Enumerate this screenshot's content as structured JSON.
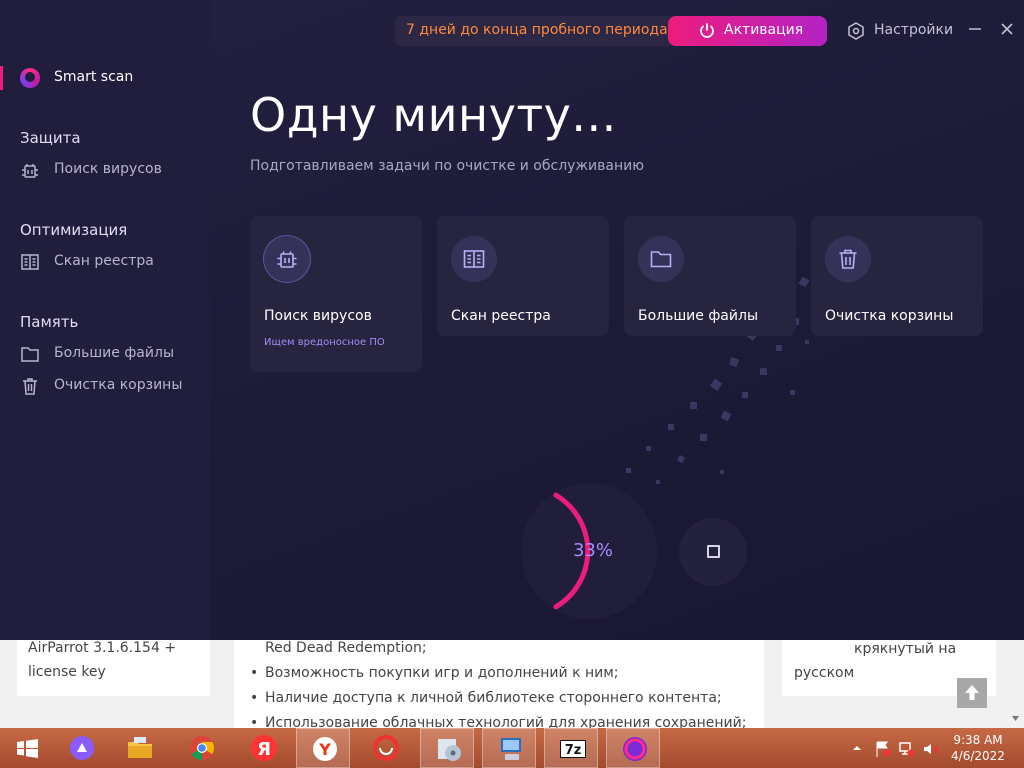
{
  "sidebar": {
    "smart_scan": "Smart scan",
    "sections": [
      {
        "title": "Защита",
        "items": [
          {
            "label": "Поиск вирусов",
            "icon": "bug-icon"
          }
        ]
      },
      {
        "title": "Оптимизация",
        "items": [
          {
            "label": "Скан реестра",
            "icon": "registry-icon"
          }
        ]
      },
      {
        "title": "Память",
        "items": [
          {
            "label": "Большие файлы",
            "icon": "folder-icon"
          },
          {
            "label": "Очистка корзины",
            "icon": "trash-icon"
          }
        ]
      }
    ]
  },
  "header": {
    "trial": "7 дней до конца пробного периода",
    "activate": "Активация",
    "settings": "Настройки"
  },
  "main": {
    "title": "Одну минуту...",
    "subtitle": "Подготавливаем задачи по очистке и обслуживанию",
    "cards": [
      {
        "name": "Поиск вирусов",
        "status": "Ищем вредоносное ПО",
        "icon": "bug-icon"
      },
      {
        "name": "Скан реестра",
        "status": "",
        "icon": "registry-icon"
      },
      {
        "name": "Большие файлы",
        "status": "",
        "icon": "folder-icon"
      },
      {
        "name": "Очистка корзины",
        "status": "",
        "icon": "trash-icon"
      }
    ],
    "progress_value": 0.33,
    "progress_text": "33%"
  },
  "colors": {
    "accent": "#ec1c7d",
    "purple": "#a78bfa",
    "trial": "#ff8a3c",
    "bg": "#1d1b38"
  },
  "webpage": {
    "left_card": [
      "AirParrot 3.1.6.154 +",
      "license key"
    ],
    "bullets_top": "Red Dead Redemption;",
    "bullets": [
      "Возможность покупки игр и дополнений к ним;",
      "Наличие доступа к личной библиотеке стороннего контента;",
      "Использование облачных технологий для хранения сохранений;"
    ],
    "right_card": [
      "крякнутый на",
      "русском"
    ]
  },
  "taskbar": {
    "time": "9:38 AM",
    "date": "4/6/2022",
    "apps": [
      "start-icon",
      "alice-icon",
      "file-explorer-icon",
      "chrome-icon",
      "yandex-icon",
      "yandex-browser-icon",
      "ccleaner-icon",
      "installer-icon",
      "setup-icon",
      "7zip-icon",
      "smart-scan-app-icon"
    ]
  }
}
